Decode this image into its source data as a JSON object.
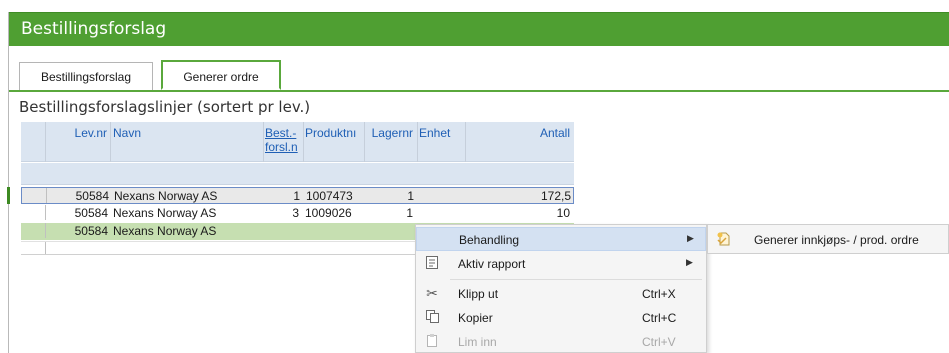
{
  "window": {
    "title": "Bestillingsforslag"
  },
  "tabs": [
    {
      "label": "Bestillingsforslag"
    },
    {
      "label": "Generer ordre"
    }
  ],
  "section": {
    "title": "Bestillingsforslagslinjer (sortert pr lev.)"
  },
  "grid": {
    "headers": {
      "levnr": "Lev.nr",
      "navn": "Navn",
      "bestforsl_line1": "Best.-",
      "bestforsl_line2": "forsl.n",
      "produktnr": "Produktnı",
      "lagernr": "Lagernr",
      "enhet": "Enhet",
      "antall": "Antall"
    },
    "rows": [
      {
        "levnr": "50584",
        "navn": "Nexans Norway AS",
        "bestforsl": "1",
        "produktnr": "1007473",
        "lagernr": "1",
        "antall": "172,5"
      },
      {
        "levnr": "50584",
        "navn": "Nexans Norway AS",
        "bestforsl": "3",
        "produktnr": "1009026",
        "lagernr": "1",
        "antall": "10"
      },
      {
        "levnr": "50584",
        "navn": "Nexans Norway AS",
        "bestforsl": "",
        "produktnr": "",
        "lagernr": "",
        "antall": ""
      }
    ]
  },
  "context_menu": {
    "items": [
      {
        "label": "Behandling",
        "shortcut": "",
        "icon": "none",
        "submenu": true
      },
      {
        "label": "Aktiv rapport",
        "shortcut": "",
        "icon": "report-icon",
        "submenu": true
      },
      {
        "label": "Klipp ut",
        "shortcut": "Ctrl+X",
        "icon": "scissors-icon",
        "submenu": false
      },
      {
        "label": "Kopier",
        "shortcut": "Ctrl+C",
        "icon": "copy-icon",
        "submenu": false
      },
      {
        "label": "Lim inn",
        "shortcut": "Ctrl+V",
        "icon": "paste-icon",
        "submenu": false
      }
    ]
  },
  "submenu": {
    "items": [
      {
        "label": "Generer innkjøps- / prod. ordre",
        "icon": "generate-order-icon"
      }
    ]
  },
  "colors": {
    "accent_green": "#4f9f32",
    "selected_row": "#c6dfb1",
    "header_bg": "#dbe5f1",
    "menu_highlight": "#d4e1f2"
  }
}
